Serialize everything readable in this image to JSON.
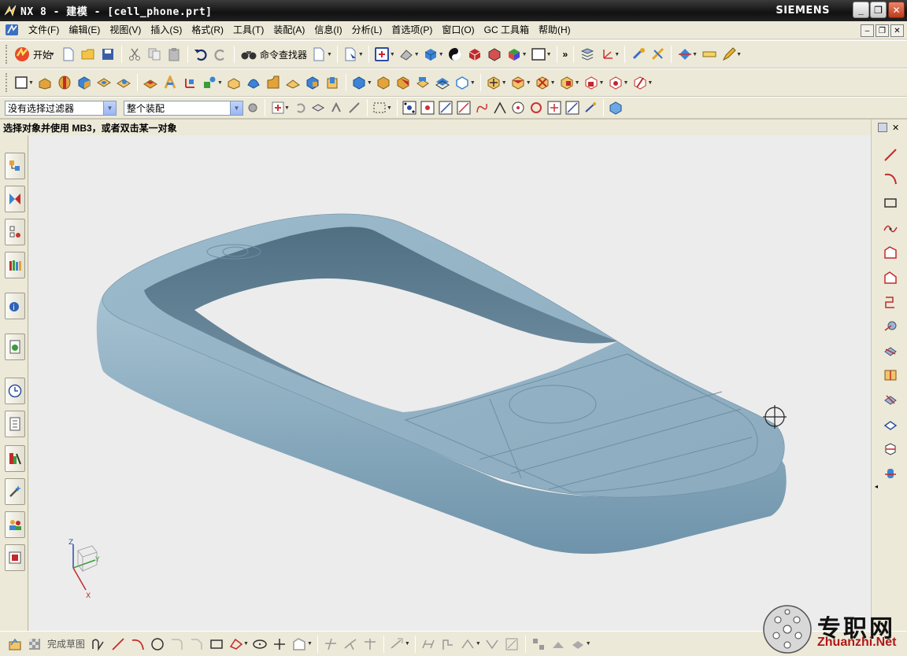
{
  "window": {
    "title": "NX 8 - 建模 - [cell_phone.prt]",
    "brand": "SIEMENS",
    "controls": {
      "minimize": "_",
      "restore": "❐",
      "close": "✕"
    }
  },
  "menubar": {
    "items": [
      "文件(F)",
      "编辑(E)",
      "视图(V)",
      "插入(S)",
      "格式(R)",
      "工具(T)",
      "装配(A)",
      "信息(I)",
      "分析(L)",
      "首选项(P)",
      "窗口(O)",
      "GC 工具箱",
      "帮助(H)"
    ]
  },
  "standard_toolbar": {
    "start_label": "开始",
    "command_finder_label": "命令查找器",
    "overflow": "»"
  },
  "selection_bar": {
    "filter_value": "没有选择过滤器",
    "scope_value": "整个装配"
  },
  "cue_line": "选择对象并使用 MB3，或者双击某一对象",
  "sketch_toolbar": {
    "finish_sketch_label": "完成草图"
  },
  "triad": {
    "z": "Z",
    "y": "Y",
    "x": "X"
  },
  "watermark": {
    "text": "专职网",
    "url": "Zhuanzhi.Net"
  },
  "colors": {
    "model_body": "#8fb0c4",
    "viewport_bg": "#ececec",
    "chrome_bg": "#ece9d8",
    "titlebar": "#1c1c1c",
    "accent_red": "#b01818"
  }
}
